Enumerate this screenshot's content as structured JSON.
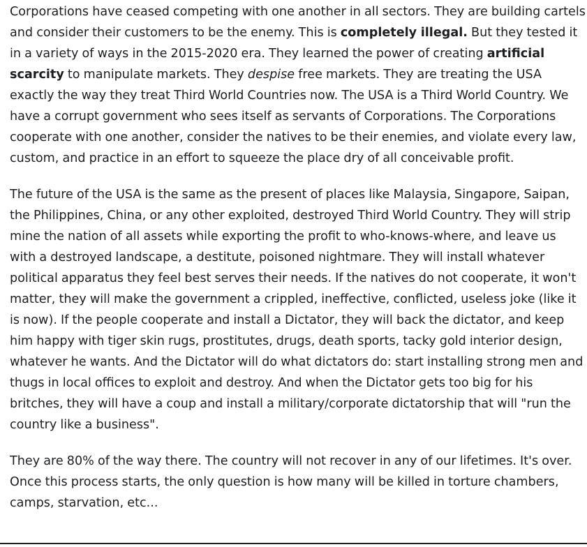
{
  "post": {
    "paragraphs": [
      {
        "segments": [
          {
            "text": "Corporations have ceased competing with one another in all sectors. They are building cartels and consider their customers to be the enemy. This is ",
            "style": "normal"
          },
          {
            "text": "completely illegal.",
            "style": "bold"
          },
          {
            "text": " But they tested it in a variety of ways in the 2015-2020 era. They learned the power of creating ",
            "style": "normal"
          },
          {
            "text": "artificial scarcity",
            "style": "bold"
          },
          {
            "text": " to manipulate markets. They ",
            "style": "normal"
          },
          {
            "text": "despise",
            "style": "italic"
          },
          {
            "text": " free markets. They are treating the USA exactly the way they treat Third World Countries now. The USA is a Third World Country. We have a corrupt government who sees itself as servants of Corporations. The Corporations cooperate with one another, consider the natives to be their enemies, and violate every law, custom, and practice in an effort to squeeze the place dry of all conceivable profit.",
            "style": "normal"
          }
        ]
      },
      {
        "segments": [
          {
            "text": "The future of the USA is the same as the present of places like Malaysia, Singapore, Saipan, the Philippines, China, or any other exploited, destroyed Third World Country. They will strip mine the nation of all assets while exporting the profit to who-knows-where, and leave us with a destroyed landscape, a destitute, poisoned nightmare. They will install whatever political apparatus they feel best serves their needs. If the natives do not cooperate, it won't matter, they will make the government a crippled, ineffective, conflicted, useless joke (like it is now). If the people cooperate and install a Dictator, they will back the dictator, and keep him happy with tiger skin rugs, prostitutes, drugs, death sports, tacky gold interior design, whatever he wants. And the Dictator will do what dictators do: start installing strong men and thugs in local offices to exploit and destroy. And when the Dictator gets too big for his britches, they will have a coup and install a military/corporate dictatorship that will \"run the country like a business\".",
            "style": "normal"
          }
        ]
      },
      {
        "segments": [
          {
            "text": "They are 80% of the way there. The country will not recover in any of our lifetimes. It's over. Once this process starts, the only question is how many will be killed in torture chambers, camps, starvation, etc...",
            "style": "normal"
          }
        ]
      }
    ]
  }
}
